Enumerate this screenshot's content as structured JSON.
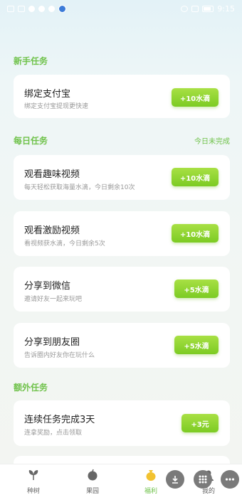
{
  "status_bar": {
    "time": "9:15"
  },
  "sections": {
    "newbie": {
      "title": "新手任务"
    },
    "daily": {
      "title": "每日任务",
      "note": "今日未完成"
    },
    "extra": {
      "title": "额外任务"
    }
  },
  "tasks": [
    {
      "title": "绑定支付宝",
      "subtitle": "绑定支付宝提现更快速",
      "reward": "+10水滴"
    },
    {
      "title": "观看趣味视频",
      "subtitle": "每天轻松获取海量水滴，今日剩余10次",
      "reward": "+10水滴"
    },
    {
      "title": "观看激励视频",
      "subtitle": "看视频获水滴，今日剩余5次",
      "reward": "+10水滴"
    },
    {
      "title": "分享到微信",
      "subtitle": "邀请好友一起来玩吧",
      "reward": "+5水滴"
    },
    {
      "title": "分享到朋友圈",
      "subtitle": "告诉圈内好友你在玩什么",
      "reward": "+5水滴"
    },
    {
      "title": "连续任务完成3天",
      "subtitle": "连拿奖励，点击领取",
      "reward": "+3元"
    }
  ],
  "tabs": [
    {
      "label": "种树",
      "icon": "sprout-icon"
    },
    {
      "label": "果园",
      "icon": "apple-icon"
    },
    {
      "label": "福利",
      "icon": "money-bag-icon",
      "active": true
    },
    {
      "label": "我的",
      "icon": "person-icon"
    }
  ],
  "colors": {
    "accent": "#6fc24a",
    "button_top": "#a8e044",
    "button_bottom": "#7ccb23"
  }
}
